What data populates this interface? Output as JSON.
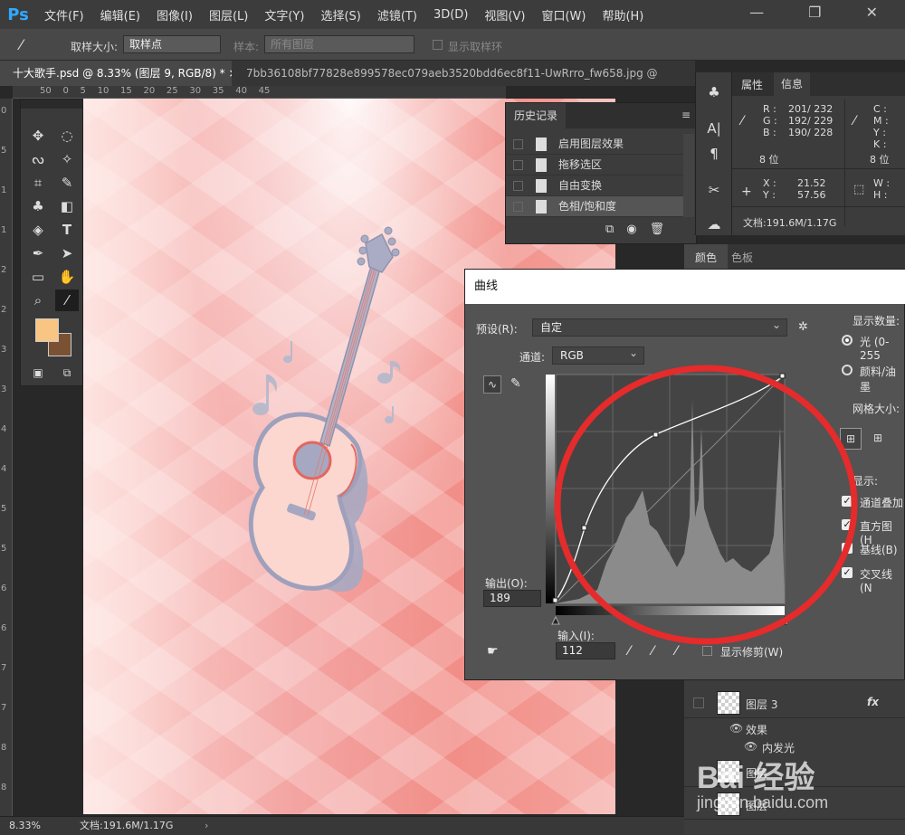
{
  "menubar": {
    "logo": "Ps",
    "items": [
      "文件(F)",
      "编辑(E)",
      "图像(I)",
      "图层(L)",
      "文字(Y)",
      "选择(S)",
      "滤镜(T)",
      "3D(D)",
      "视图(V)",
      "窗口(W)",
      "帮助(H)"
    ],
    "window_controls": "—  ❐  ✕"
  },
  "options": {
    "sample_size_label": "取样大小:",
    "sample_size_value": "取样点",
    "sample_label": "样本:",
    "sample_value": "所有图层",
    "show_ring_label": "显示取样环"
  },
  "tabs": [
    "十大歌手.psd @ 8.33% (图层 9, RGB/8) *  ×",
    "7bb36108bf77828e899578ec079aeb3520bdd6ec8f11-UwRrro_fw658.jpg @ 2..."
  ],
  "ruler_top": "50    0    5    10    15    20    25    30    35    40    45",
  "ruler_left": [
    "0",
    "5",
    "1",
    "1",
    "2",
    "2",
    "3",
    "3",
    "4",
    "4",
    "5",
    "5",
    "6",
    "6",
    "7",
    "7",
    "8",
    "8"
  ],
  "tools": [
    {
      "icon": "move-icon",
      "glyph": "✥"
    },
    {
      "icon": "marquee-icon",
      "glyph": "◌"
    },
    {
      "icon": "lasso-icon",
      "glyph": "ᔓ"
    },
    {
      "icon": "magic-wand-icon",
      "glyph": "✧"
    },
    {
      "icon": "crop-icon",
      "glyph": "⌗"
    },
    {
      "icon": "brush-icon",
      "glyph": "✎"
    },
    {
      "icon": "stamp-icon",
      "glyph": "♣"
    },
    {
      "icon": "eraser-icon",
      "glyph": "◧"
    },
    {
      "icon": "bucket-icon",
      "glyph": "◈"
    },
    {
      "icon": "type-icon",
      "glyph": "T"
    },
    {
      "icon": "pen-icon",
      "glyph": "✒"
    },
    {
      "icon": "path-select-icon",
      "glyph": "➤"
    },
    {
      "icon": "shape-icon",
      "glyph": "▭"
    },
    {
      "icon": "hand-icon",
      "glyph": "✋"
    },
    {
      "icon": "zoom-icon",
      "glyph": "⌕"
    },
    {
      "icon": "eyedropper-icon",
      "glyph": "⁄"
    }
  ],
  "history": {
    "title": "历史记录",
    "rows": [
      "启用图层效果",
      "拖移选区",
      "自由变换",
      "色相/饱和度"
    ]
  },
  "info": {
    "tabs": [
      "属性",
      "信息"
    ],
    "rgb_labels": [
      "R :",
      "G :",
      "B :"
    ],
    "rgb_values": [
      "201/ 232",
      "192/ 229",
      "190/ 228"
    ],
    "cmyk_labels": [
      "C :",
      "M :",
      "Y :",
      "K :"
    ],
    "bit_depth": "8 位",
    "bit_depth_2": "8 位",
    "xy_labels": [
      "X :",
      "Y :"
    ],
    "xy_values": [
      "21.52",
      "57.56"
    ],
    "wh_labels": [
      "W :",
      "H :"
    ],
    "doc_size": "文档:191.6M/1.17G"
  },
  "color_panel": {
    "tabs": [
      "颜色",
      "色板"
    ]
  },
  "curves": {
    "title": "曲线",
    "preset_label": "预设(R):",
    "preset_value": "自定",
    "channel_label": "通道:",
    "channel_value": "RGB",
    "output_label": "输出(O):",
    "output_value": "189",
    "input_label": "输入(I):",
    "input_value": "112",
    "show_clipping_label": "显示修剪(W)",
    "show_amount_label": "显示数量:",
    "light_option": "光 (0-255",
    "pigment_option": "颜料/油墨",
    "grid_size_label": "网格大小:",
    "display_label": "显示:",
    "display_options": [
      "通道叠加",
      "直方图(H",
      "基线(B)",
      "交叉线(N"
    ]
  },
  "layers": {
    "rows": [
      "图层 3",
      "效果",
      "内发光",
      "图层",
      "图层"
    ]
  },
  "statusbar": {
    "zoom": "8.33%",
    "doc": "文档:191.6M/1.17G"
  },
  "watermark": {
    "main": "Bai 经验",
    "sub": "jingyan.baidu.com"
  },
  "colors": {
    "ps_blue": "#31a8ff",
    "foreground": "#f8c583",
    "background": "#7a5233",
    "annotation_red": "#e52b2b"
  }
}
